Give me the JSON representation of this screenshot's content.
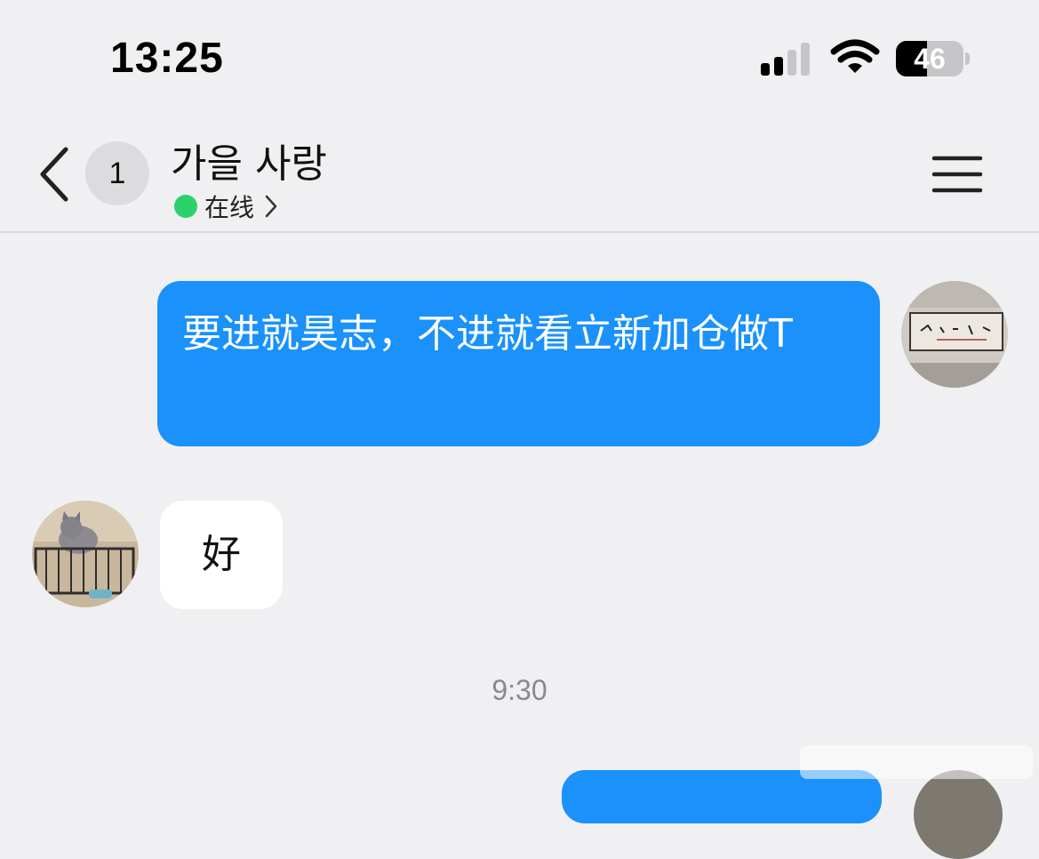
{
  "status_bar": {
    "time": "13:25",
    "battery_level": "46",
    "battery_fraction": 0.46,
    "signal_bars_active": 2,
    "signal_bars_total": 4
  },
  "nav": {
    "unread_count": "1",
    "title": "가을 사랑",
    "online_status": "在线",
    "online_color": "#2cd16b",
    "back_icon": "chevron-left-icon",
    "menu_icon": "hamburger-menu-icon"
  },
  "messages": [
    {
      "direction": "outgoing",
      "text": "要进就昊志，不进就看立新加仓做T",
      "bubble_color": "#1a91fb"
    },
    {
      "direction": "incoming",
      "text": "好",
      "bubble_color": "#ffffff"
    }
  ],
  "timestamp": "9:30"
}
